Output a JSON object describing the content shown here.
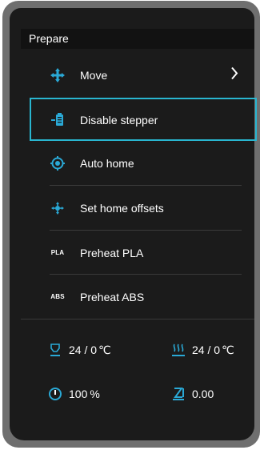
{
  "menu": {
    "title": "Prepare",
    "items": [
      {
        "label": "Move",
        "icon": "move-arrows-icon",
        "has_submenu": true
      },
      {
        "label": "Disable stepper",
        "icon": "disable-stepper-icon",
        "selected": true
      },
      {
        "label": "Auto home",
        "icon": "auto-home-icon"
      },
      {
        "label": "Set home offsets",
        "icon": "set-home-offsets-icon"
      },
      {
        "label": "Preheat PLA",
        "icon_text": "PLA"
      },
      {
        "label": "Preheat ABS",
        "icon_text": "ABS"
      }
    ]
  },
  "status": {
    "nozzle": {
      "value": "24 / 0",
      "unit": "℃",
      "icon": "nozzle-icon"
    },
    "bed": {
      "value": "24 / 0",
      "unit": "℃",
      "icon": "bed-heat-icon"
    },
    "speed": {
      "value": "100",
      "unit": "%",
      "icon": "speed-gauge-icon"
    },
    "z_offset": {
      "value": "0.00",
      "icon": "z-offset-icon"
    }
  },
  "colors": {
    "accent": "#29b6d0",
    "background": "#1b1b1b",
    "bezel": "#6f6f6f"
  }
}
